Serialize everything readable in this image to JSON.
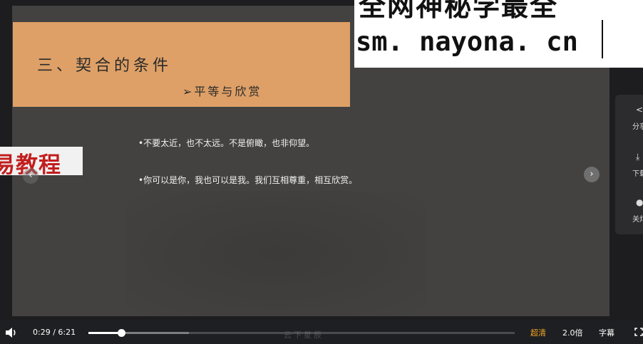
{
  "slide": {
    "title": "三、契合的条件",
    "subtitle": "➢平等与欣赏",
    "bullets": [
      "•不要太近，也不太远。不是俯瞰，也非仰望。",
      "•你可以是你，我也可以是我。我们互相尊重，相互欣赏。"
    ]
  },
  "overlays": {
    "watermark_line1": "全网神秘学最全",
    "watermark_line2": "sm. nayona. cn",
    "tag_text": "易教程",
    "bottom_mark": "云下星辰"
  },
  "nav": {
    "prev_icon": "‹",
    "next_icon": "›"
  },
  "side_panel": {
    "items": [
      {
        "icon": "share-icon",
        "glyph": "<",
        "label": "分享"
      },
      {
        "icon": "download-icon",
        "glyph": "⤓",
        "label": "下载"
      },
      {
        "icon": "light-toggle-icon",
        "glyph": "●",
        "label": "关灯"
      }
    ]
  },
  "player": {
    "current_time": "0:29",
    "separator": "/",
    "duration": "6:21",
    "progress_fraction": 0.0761,
    "buffered_fraction": 0.235,
    "quality": "超清",
    "speed": "2.0倍",
    "subtitles": "字幕",
    "accent_color": "#f5a623"
  },
  "colors": {
    "slide_background": "#434241",
    "title_box": "#dea067",
    "tag_red": "#c21e1e"
  }
}
